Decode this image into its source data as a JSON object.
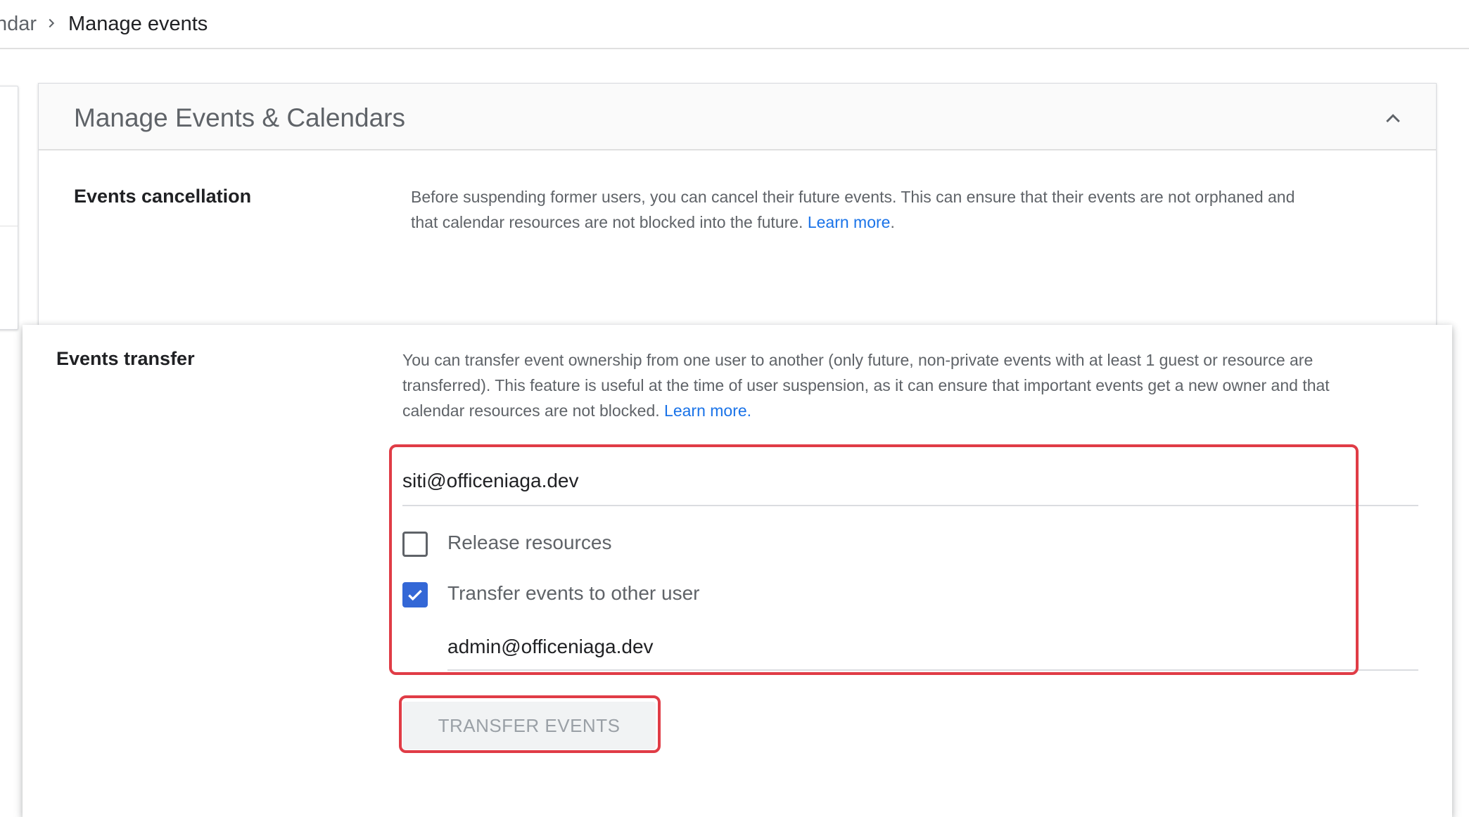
{
  "breadcrumb": {
    "previous": "ndar",
    "current": "Manage events"
  },
  "card": {
    "title": "Manage Events & Calendars"
  },
  "cancellation": {
    "label": "Events cancellation",
    "description_line1": "Before suspending former users, you can cancel their future events. This can ensure that their events are not orphaned and",
    "description_line2": "that calendar resources are not blocked into the future.",
    "learn_more": "Learn more",
    "period": "."
  },
  "transfer": {
    "label": "Events transfer",
    "description_line1": "You can transfer event ownership from one user to another (only future, non-private events with at least 1 guest or resource are",
    "description_line2": "transferred). This feature is useful at the time of user suspension, as it can ensure that important events get a new owner and that",
    "description_line3": "calendar resources are not blocked.",
    "learn_more": "Learn more.",
    "source_user": "siti@officeniaga.dev",
    "release_resources_label": "Release resources",
    "release_resources_checked": false,
    "transfer_to_other_label": "Transfer events to other user",
    "transfer_to_other_checked": true,
    "target_user": "admin@officeniaga.dev",
    "button_label": "TRANSFER EVENTS"
  },
  "colors": {
    "accent": "#1a73e8",
    "checkbox": "#3367d6",
    "highlight": "#e03c46"
  },
  "icons": {
    "breadcrumb_separator": "chevron-right-icon",
    "collapse": "chevron-up-icon",
    "check": "check-icon"
  }
}
